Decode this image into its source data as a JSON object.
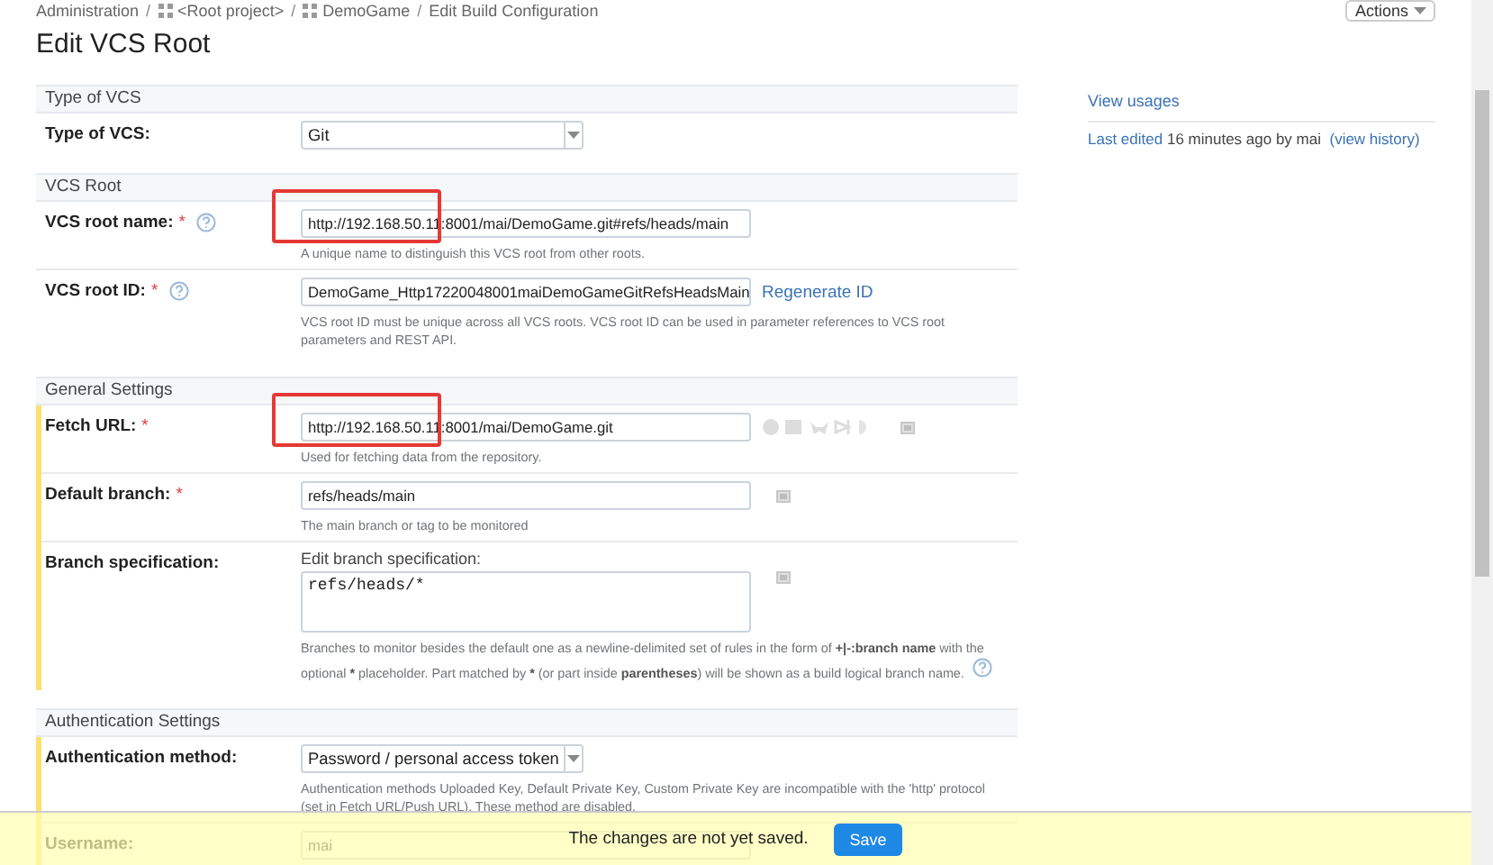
{
  "breadcrumbs": [
    {
      "label": "Administration",
      "kind": "link",
      "separator": "/"
    },
    {
      "label": "<Root project>",
      "kind": "project",
      "separator": "/"
    },
    {
      "label": "DemoGame",
      "kind": "project",
      "separator": "/"
    },
    {
      "label": "Edit Build Configuration",
      "kind": "link"
    }
  ],
  "actions_button": "Actions",
  "title": "Edit VCS Root",
  "sections": [
    {
      "title": "Type of VCS",
      "modified": false,
      "rows": [
        {
          "kind": "select",
          "label": "Type of VCS:",
          "value": "Git",
          "highlighted": false
        }
      ]
    },
    {
      "title": "VCS Root",
      "modified": false,
      "rows": [
        {
          "kind": "text",
          "label": "VCS root name:",
          "required_mark": "*",
          "help": true,
          "value": "http://192.168.50.11:8001/mai/DemoGame.git#refs/heads/main",
          "hint": "A unique name to distinguish this VCS root from other roots.",
          "highlighted": true
        },
        {
          "kind": "text",
          "label": "VCS root ID:",
          "required_mark": "*",
          "help": true,
          "value": "DemoGame_Http17220048001maiDemoGameGitRefsHeadsMain",
          "link": "Regenerate ID",
          "hint": "VCS root ID must be unique across all VCS roots. VCS root ID can be used in parameter references to VCS root parameters and REST API.",
          "highlighted": false
        }
      ]
    },
    {
      "title": "General Settings",
      "modified": true,
      "rows": [
        {
          "kind": "text",
          "label": "Fetch URL:",
          "required_mark": "*",
          "value": "http://192.168.50.11:8001/mai/DemoGame.git",
          "repo_icons": true,
          "side_icon": true,
          "hint": "Used for fetching data from the repository.",
          "highlighted": true
        },
        {
          "kind": "text",
          "label": "Default branch:",
          "required_mark": "*",
          "value": "refs/heads/main",
          "side_icon": true,
          "hint": "The main branch or tag to be monitored",
          "highlighted": false
        },
        {
          "kind": "textarea",
          "label": "Branch specification:",
          "caption": "Edit branch specification:",
          "value": "refs/heads/*",
          "side_icon": true,
          "help_after_hint": true,
          "hint_parts": [
            {
              "text": "Branches to monitor besides the default one as a newline-delimited set of rules in the form of "
            },
            {
              "text": "+|-:branch name",
              "bold": true
            },
            {
              "text": " with the optional "
            },
            {
              "text": "*",
              "bold": true
            },
            {
              "text": " placeholder. Part matched by "
            },
            {
              "text": "*",
              "bold": true
            },
            {
              "text": " (or part inside "
            },
            {
              "text": "parentheses",
              "bold": true
            },
            {
              "text": ") will be shown as a build logical branch name."
            }
          ],
          "highlighted": false
        }
      ]
    },
    {
      "title": "Authentication Settings",
      "modified": true,
      "rows": [
        {
          "kind": "select",
          "label": "Authentication method:",
          "value": "Password / personal access token",
          "hint": "Authentication methods Uploaded Key, Default Private Key, Custom Private Key are incompatible with the 'http' protocol (set in Fetch URL/Push URL). These method are disabled.",
          "highlighted": false
        },
        {
          "kind": "text",
          "label": "Username:",
          "value": "mai",
          "highlighted": false
        }
      ]
    }
  ],
  "side_panel": {
    "view_usages": "View usages",
    "last_edited_link": "Last edited",
    "last_edited_text": "16 minutes ago by mai",
    "history_link": "(view history)"
  },
  "save_bar": {
    "message": "The changes are not yet saved.",
    "button": "Save"
  }
}
